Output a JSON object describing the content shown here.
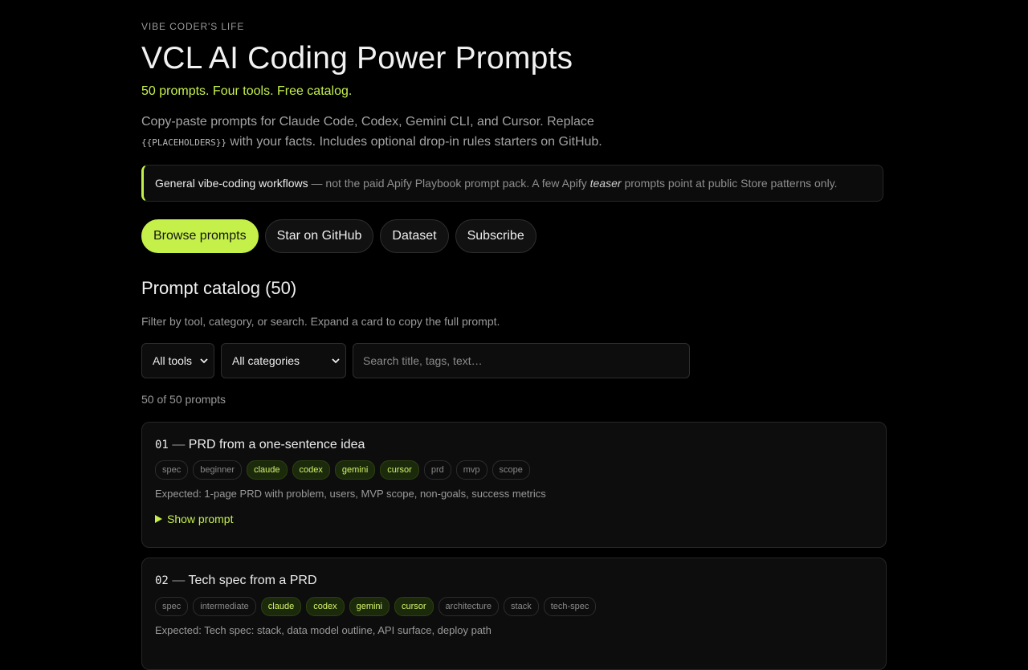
{
  "header": {
    "eyebrow": "VIBE CODER'S LIFE",
    "title": "VCL AI Coding Power Prompts",
    "tagline": "50 prompts. Four tools. Free catalog.",
    "lede_part1": "Copy-paste prompts for Claude Code, Codex, Gemini CLI, and Cursor. Replace",
    "lede_code": "{{PLACEHOLDERS}}",
    "lede_part2": "with your facts. Includes optional drop-in rules starters on GitHub."
  },
  "notice": {
    "strong": "General vibe-coding workflows",
    "text1": "— not the paid Apify Playbook prompt pack. A few Apify",
    "em": "teaser",
    "text2": "prompts point at public Store patterns only.",
    "accent_color": "#c5f04a"
  },
  "actions": {
    "browse": "Browse prompts",
    "github": "Star on GitHub",
    "dataset": "Dataset",
    "subscribe": "Subscribe"
  },
  "catalog": {
    "heading": "Prompt catalog (50)",
    "subtitle": "Filter by tool, category, or search. Expand a card to copy the full prompt.",
    "tool_filter": "All tools",
    "category_filter": "All categories",
    "search_placeholder": "Search title, tags, text…",
    "count": "50 of 50 prompts",
    "show_prompt": "Show prompt",
    "cards": [
      {
        "num": "01",
        "sep": "—",
        "title": "PRD from a one-sentence idea",
        "tags": [
          "spec",
          "beginner",
          "claude",
          "codex",
          "gemini",
          "cursor",
          "prd",
          "mvp",
          "scope"
        ],
        "expected": "Expected: 1-page PRD with problem, users, MVP scope, non-goals, success metrics"
      },
      {
        "num": "02",
        "sep": "—",
        "title": "Tech spec from a PRD",
        "tags": [
          "spec",
          "intermediate",
          "claude",
          "codex",
          "gemini",
          "cursor",
          "architecture",
          "stack",
          "tech-spec"
        ],
        "expected": "Expected: Tech spec: stack, data model outline, API surface, deploy path"
      }
    ]
  }
}
